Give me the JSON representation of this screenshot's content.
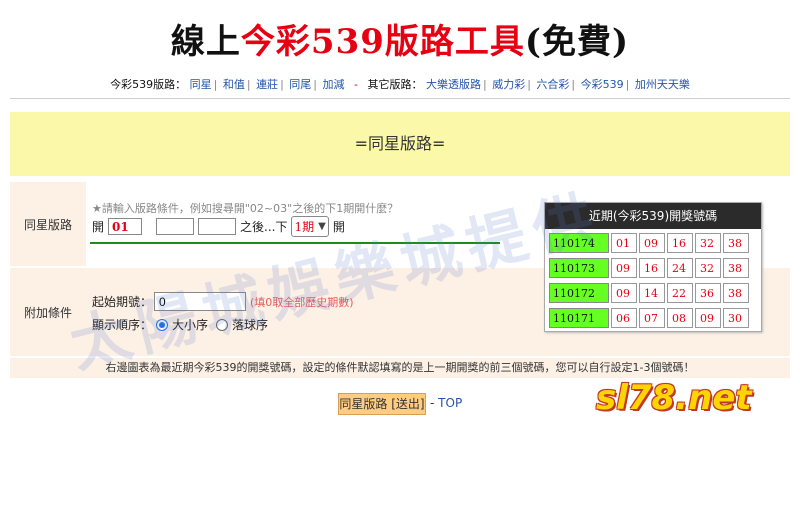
{
  "header": {
    "title_black_1": "線上",
    "title_red": "今彩539版路工具",
    "title_black_2": "(免費)"
  },
  "nav": {
    "label_539": "今彩539版路：",
    "items_539": [
      "同星",
      "和值",
      "連莊",
      "同尾",
      "加減"
    ],
    "dash": "-",
    "label_other": "其它版路：",
    "items_other": [
      "大樂透版路",
      "威力彩",
      "六合彩",
      "今彩539",
      "加州天天樂"
    ]
  },
  "banner": {
    "text": "=同星版路="
  },
  "form": {
    "row1_label": "同星版路",
    "hint": "★請輸入版路條件，例如搜尋開\"02~03\"之後的下1期開什麼？",
    "open_label": "開",
    "num1": "01",
    "num2": "",
    "num3": "",
    "after_label": "之後...下",
    "period_selected": "1期",
    "open_label_2": "開",
    "row2_label": "附加條件",
    "start_label": "起始期號：",
    "start_value": "0",
    "start_note": "(填0取全部歷史期數)",
    "order_label": "顯示順序：",
    "order_option_1": "大小序",
    "order_option_2": "落球序",
    "order_selected": "大小序"
  },
  "recent": {
    "title": "近期(今彩539)開獎號碼",
    "rows": [
      {
        "issue": "110174",
        "balls": [
          "01",
          "09",
          "16",
          "32",
          "38"
        ]
      },
      {
        "issue": "110173",
        "balls": [
          "09",
          "16",
          "24",
          "32",
          "38"
        ]
      },
      {
        "issue": "110172",
        "balls": [
          "09",
          "14",
          "22",
          "36",
          "38"
        ]
      },
      {
        "issue": "110171",
        "balls": [
          "06",
          "07",
          "08",
          "09",
          "30"
        ]
      }
    ]
  },
  "note": "右邊圖表為最近期今彩539的開獎號碼，設定的條件默認填寫的是上一期開獎的前三個號碼，您可以自行設定1-3個號碼！",
  "actions": {
    "submit_label": "同星版路 [送出]",
    "top_prefix": "-",
    "top_label": "TOP"
  },
  "watermark": "太陽城娛樂城提供",
  "brand": "sl78.net"
}
